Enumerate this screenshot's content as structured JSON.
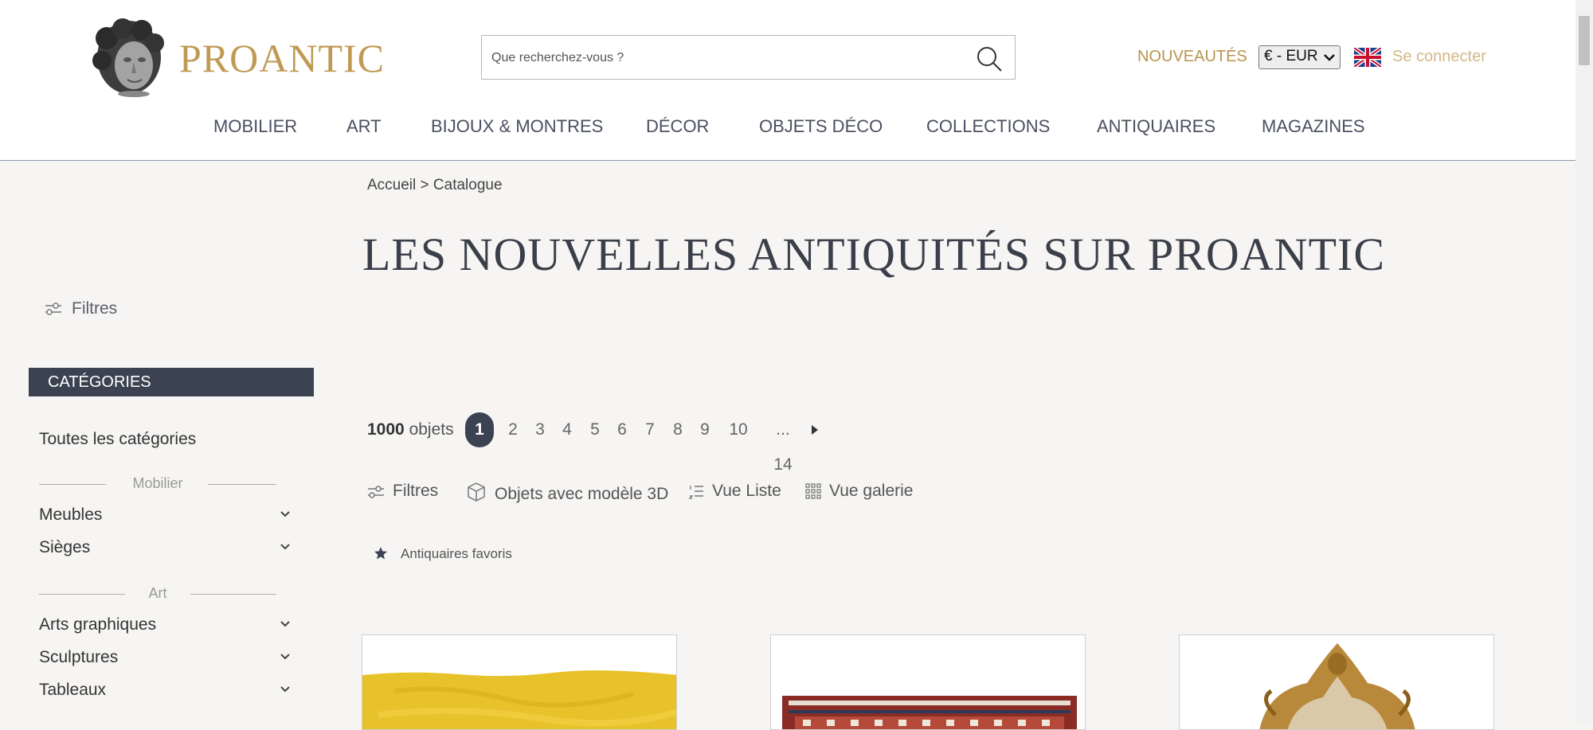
{
  "header": {
    "brand": "PROANTIC",
    "search_placeholder": "Que recherchez-vous ?",
    "nouveautes": "NOUVEAUTÉS",
    "currency": "€ - EUR",
    "login": "Se connecter",
    "nav": [
      "MOBILIER",
      "ART",
      "BIJOUX & MONTRES",
      "DÉCOR",
      "OBJETS DÉCO",
      "COLLECTIONS",
      "ANTIQUAIRES",
      "MAGAZINES"
    ]
  },
  "sidebar": {
    "filter_label": "Filtres",
    "categories_title": "CATÉGORIES",
    "all_categories": "Toutes les catégories",
    "groups": [
      {
        "label": "Mobilier",
        "items": [
          "Meubles",
          "Sièges"
        ]
      },
      {
        "label": "Art",
        "items": [
          "Arts graphiques",
          "Sculptures",
          "Tableaux"
        ]
      }
    ]
  },
  "main": {
    "breadcrumb": {
      "home": "Accueil",
      "separator": ">",
      "current": "Catalogue"
    },
    "title": "LES NOUVELLES ANTIQUITÉS SUR PROANTIC",
    "count_number": "1000",
    "count_label": "objets",
    "pages": [
      "1",
      "2",
      "3",
      "4",
      "5",
      "6",
      "7",
      "8",
      "9",
      "10",
      "... 14"
    ],
    "current_page": "1",
    "toolbar": {
      "filters": "Filtres",
      "models3d": "Objets avec modèle 3D",
      "list_view": "Vue Liste",
      "gallery_view": "Vue galerie"
    },
    "favorites": "Antiquaires favoris"
  },
  "colors": {
    "accent_gold": "#c09a55",
    "dark_navy": "#3b4352",
    "background": "#f6f5f3"
  }
}
